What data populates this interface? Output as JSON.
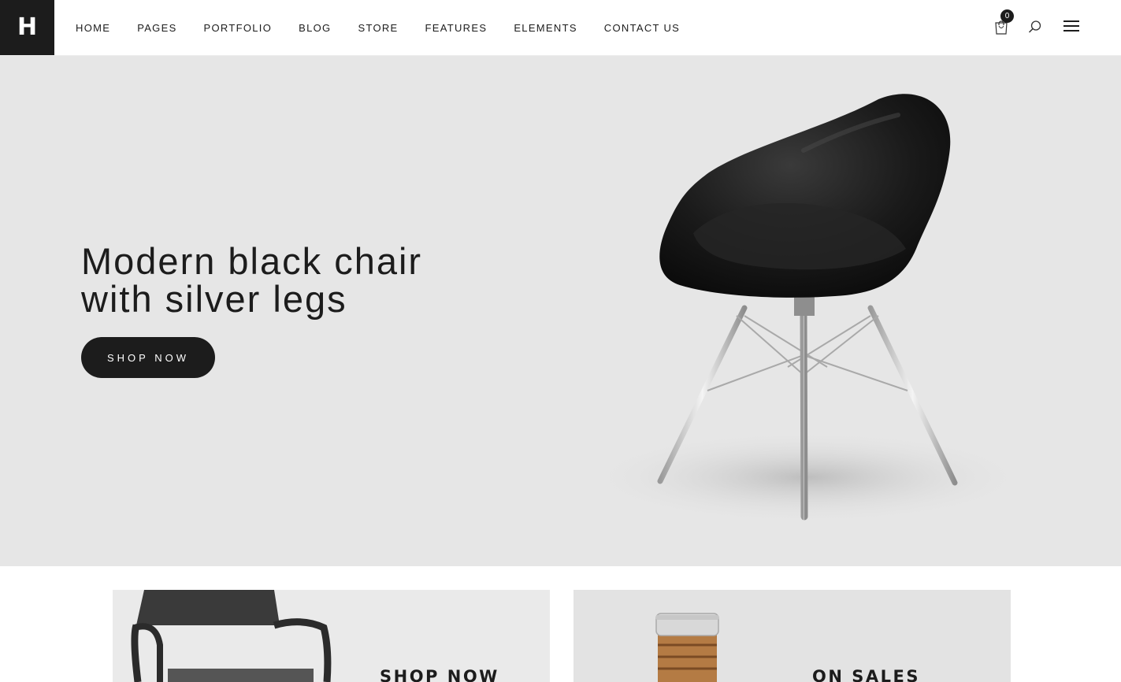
{
  "header": {
    "logo_letter": "H",
    "nav": [
      "HOME",
      "PAGES",
      "PORTFOLIO",
      "BLOG",
      "STORE",
      "FEATURES",
      "ELEMENTS",
      "CONTACT US"
    ],
    "cart_count": "0",
    "icons": [
      "cart-icon",
      "search-icon",
      "hamburger-menu-icon"
    ]
  },
  "hero": {
    "title_line1": "Modern black chair",
    "title_line2": "with silver legs",
    "cta_label": "SHOP NOW",
    "image": "black-chair-silver-legs"
  },
  "banners": [
    {
      "label": "SHOP NOW",
      "image": "dark-armchair"
    },
    {
      "label": "ON SALES",
      "image": "glass-jar-cork"
    }
  ],
  "colors": {
    "dark": "#1c1c1c",
    "hero_bg": "#e6e6e6",
    "page_bg": "#ffffff"
  }
}
